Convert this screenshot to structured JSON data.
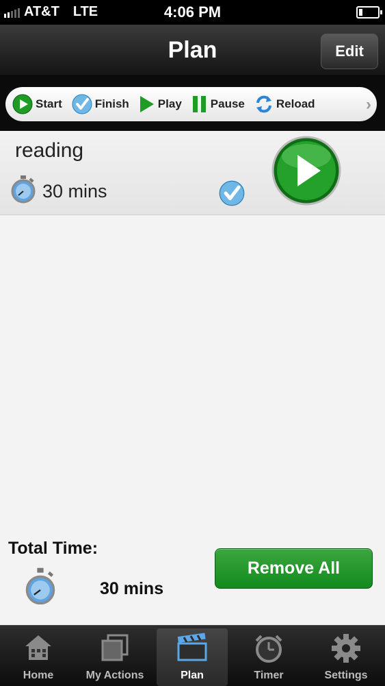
{
  "status_bar": {
    "carrier": "AT&T",
    "network": "LTE",
    "time": "4:06 PM"
  },
  "nav": {
    "title": "Plan",
    "edit_label": "Edit"
  },
  "legend": {
    "items": [
      {
        "label": "Start",
        "icon": "start-icon"
      },
      {
        "label": "Finish",
        "icon": "finish-check-icon"
      },
      {
        "label": "Play",
        "icon": "play-icon"
      },
      {
        "label": "Pause",
        "icon": "pause-icon"
      },
      {
        "label": "Reload",
        "icon": "reload-icon"
      }
    ]
  },
  "plan": {
    "items": [
      {
        "name": "reading",
        "duration": "30 mins"
      }
    ]
  },
  "footer": {
    "total_label": "Total Time:",
    "total_value": "30 mins",
    "remove_all_label": "Remove All"
  },
  "tabs": [
    {
      "label": "Home",
      "icon": "home-icon"
    },
    {
      "label": "My Actions",
      "icon": "actions-icon"
    },
    {
      "label": "Plan",
      "icon": "clapperboard-icon",
      "active": true
    },
    {
      "label": "Timer",
      "icon": "alarm-clock-icon"
    },
    {
      "label": "Settings",
      "icon": "gear-icon"
    }
  ],
  "colors": {
    "accent_green": "#1a9a27",
    "tab_active": "#ffffff",
    "check_blue": "#3a9ad9"
  }
}
